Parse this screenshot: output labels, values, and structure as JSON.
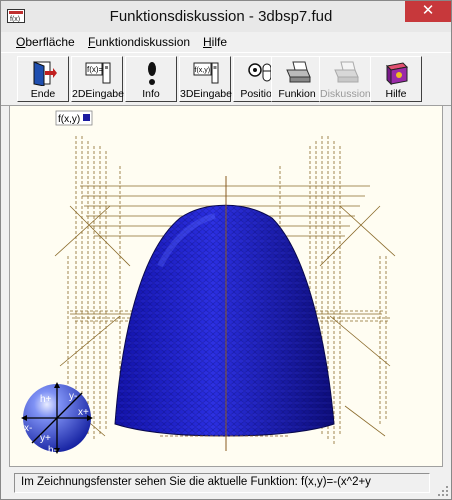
{
  "window": {
    "title": "Funktionsdiskussion - 3dbsp7.fud",
    "close_glyph": "✕"
  },
  "menu": [
    {
      "label": "Oberfläche"
    },
    {
      "label": "Funktiondiskussion"
    },
    {
      "label": "Hilfe"
    }
  ],
  "toolbar": [
    {
      "label": "Ende",
      "icon": "exit-door-icon",
      "enabled": true
    },
    {
      "label": "2DEingabe",
      "icon": "fx-input-icon",
      "enabled": true
    },
    {
      "label": "Info",
      "icon": "info-exclamation-icon",
      "enabled": true
    },
    {
      "label": "3DEingabe",
      "icon": "fxy-input-icon",
      "enabled": true
    },
    {
      "label": "Position",
      "icon": "position-mouse-icon",
      "enabled": true
    },
    {
      "label": "Funkion",
      "icon": "printer-icon",
      "enabled": true
    },
    {
      "label": "Diskussion",
      "icon": "printer-disabled-icon",
      "enabled": false
    },
    {
      "label": "Hilfe",
      "icon": "help-book-icon",
      "enabled": true
    }
  ],
  "plot": {
    "legend_label": "f(x,y)",
    "legend_color": "#1a1aa0",
    "surface_color": "#1e22c8",
    "grid_color": "#8a6a2a",
    "nav_labels": {
      "h_up": "h+",
      "h_down": "h-",
      "x_plus": "x+",
      "x_minus": "x-",
      "y_plus": "y+",
      "y_minus": "y-"
    }
  },
  "status": {
    "text": "Im Zeichnungsfenster sehen Sie die aktuelle Funktion: f(x,y)=-(x^2+y"
  }
}
